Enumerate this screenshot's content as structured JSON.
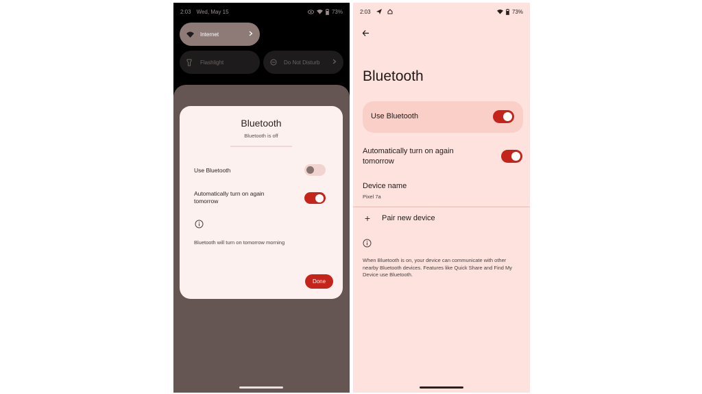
{
  "left_screen": {
    "status_bar": {
      "time": "2:03",
      "date": "Wed, May 15",
      "battery": "73%"
    },
    "quick_settings": {
      "internet": {
        "label": "Internet"
      },
      "flashlight": {
        "label": "Flashlight"
      },
      "do_not_disturb": {
        "label": "Do Not Disturb"
      }
    },
    "dialog": {
      "title": "Bluetooth",
      "subtitle": "Bluetooth is off",
      "use_bluetooth": {
        "label": "Use Bluetooth",
        "state": "off"
      },
      "auto_turn_on": {
        "label": "Automatically turn on again tomorrow",
        "state": "on"
      },
      "info_note": "Bluetooth will turn on tomorrow morning",
      "done_label": "Done"
    }
  },
  "right_screen": {
    "status_bar": {
      "time": "2:03",
      "battery": "73%"
    },
    "title": "Bluetooth",
    "use_bluetooth": {
      "label": "Use Bluetooth",
      "state": "on"
    },
    "auto_turn_on": {
      "label": "Automatically turn on again tomorrow",
      "state": "on"
    },
    "device_name": {
      "label": "Device name",
      "value": "Pixel 7a"
    },
    "pair_new_device": {
      "label": "Pair new device"
    },
    "info_text": "When Bluetooth is on, your device can communicate with other nearby Bluetooth devices. Features like Quick Share and Find My Device use Bluetooth."
  },
  "colors": {
    "accent": "#c5241a",
    "right_background": "#fde2de",
    "dialog_background": "#fdf1ef",
    "scrim": "#655653"
  }
}
